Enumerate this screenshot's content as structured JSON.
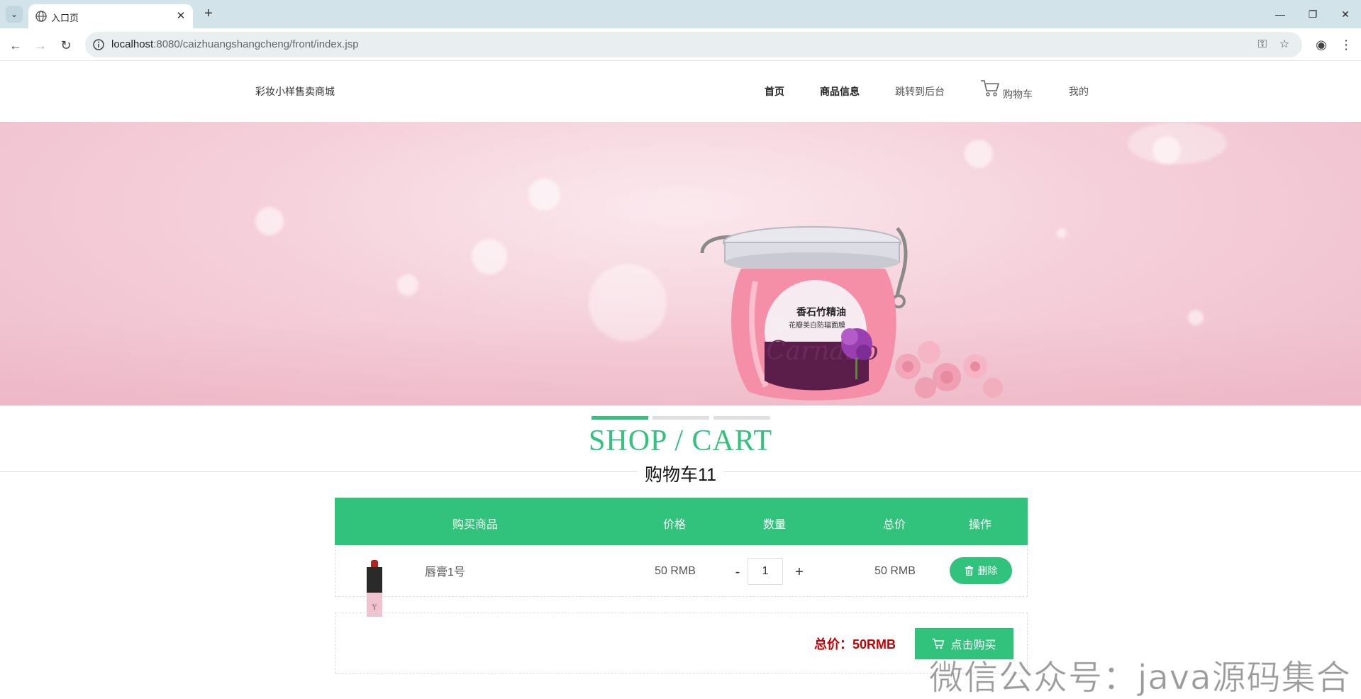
{
  "browser": {
    "tab_title": "入口页",
    "url_host": "localhost",
    "url_rest": ":8080/caizhuangshangcheng/front/index.jsp",
    "icons": [
      "tab-list-icon",
      "globe-icon",
      "close-icon",
      "plus-icon",
      "back-icon",
      "forward-icon",
      "reload-icon",
      "site-info-icon",
      "password-key-icon",
      "bookmark-star-icon",
      "profile-icon",
      "menu-icon",
      "minimize-icon",
      "restore-icon",
      "window-close-icon"
    ]
  },
  "site": {
    "logo": "彩妆小样售卖商城",
    "nav": {
      "home": "首页",
      "products": "商品信息",
      "backend": "跳转到后台",
      "cart": "购物车",
      "mine": "我的"
    }
  },
  "banner": {
    "product_label_line1": "香石竹精油",
    "product_label_line2": "花瓣美白防辐面膜",
    "product_script": "Carnatio",
    "active_slide": 1,
    "slide_count": 3
  },
  "section": {
    "title_en": "SHOP / CART",
    "title_cn": "购物车11"
  },
  "cart": {
    "headers": {
      "product": "购买商品",
      "price": "价格",
      "quantity": "数量",
      "total": "总价",
      "action": "操作"
    },
    "items": [
      {
        "name": "唇膏1号",
        "price": "50 RMB",
        "quantity": "1",
        "subtotal": "50 RMB",
        "delete_label": "删除",
        "minus_label": "-",
        "plus_label": "+"
      }
    ],
    "total_label": "总价：50RMB",
    "buy_label": "点击购买"
  },
  "watermark": "微信公众号：java源码集合",
  "colors": {
    "accent": "#31c27c",
    "total_red": "#c50000",
    "banner_pink": "#f5d0da"
  }
}
